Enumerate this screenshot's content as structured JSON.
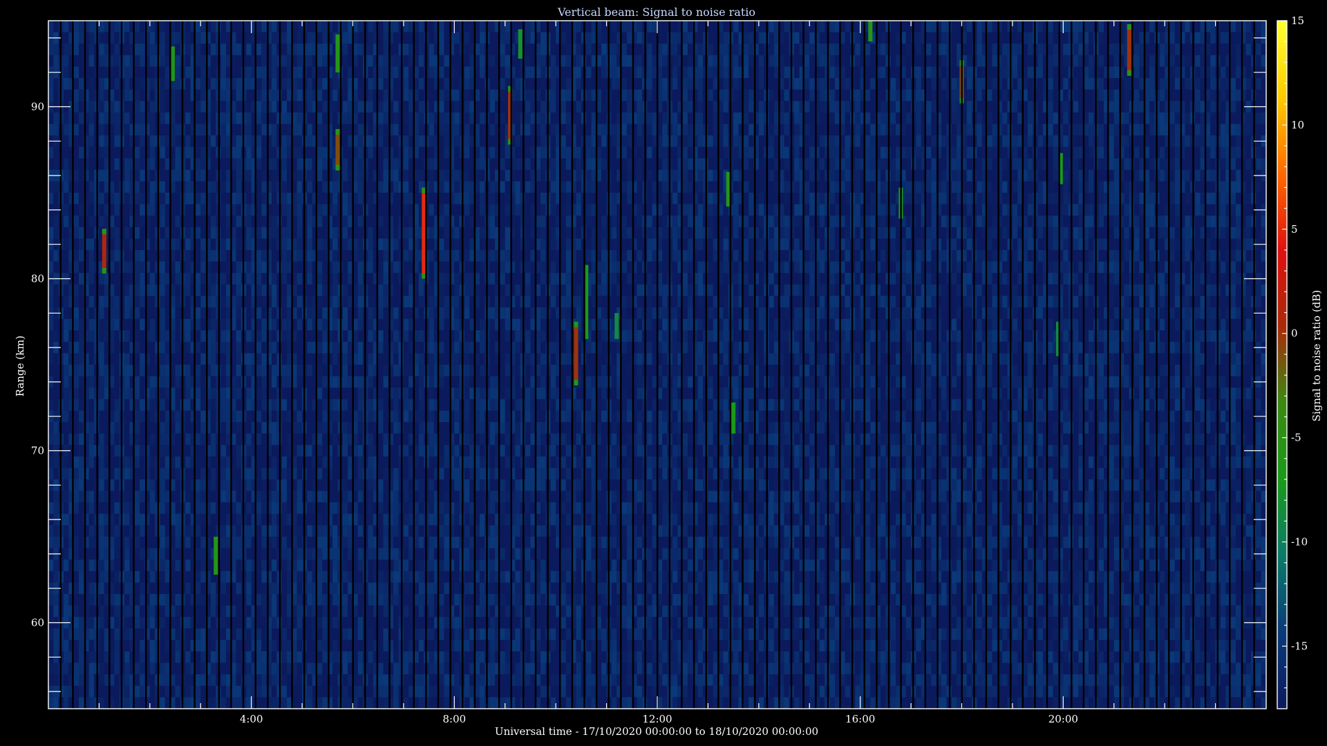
{
  "chart_data": {
    "type": "heatmap",
    "title": "Vertical beam: Signal to noise ratio",
    "xlabel": "Universal time - 17/10/2020 00:00:00 to 18/10/2020 00:00:00",
    "ylabel": "Range (km)",
    "colorbar_label": "Signal to noise ratio (dB)",
    "x_unit": "hours UT",
    "xlim": [
      0,
      24
    ],
    "ylim": [
      55,
      95
    ],
    "x_ticks": [
      4,
      8,
      12,
      16,
      20
    ],
    "x_tick_labels": [
      "4:00",
      "8:00",
      "12:00",
      "16:00",
      "20:00"
    ],
    "y_ticks": [
      60,
      70,
      80,
      90
    ],
    "y_tick_labels": [
      "60",
      "70",
      "80",
      "90"
    ],
    "colorbar_range": [
      -18,
      15
    ],
    "colorbar_ticks": [
      15,
      10,
      5,
      0,
      -5,
      -10,
      -15
    ],
    "colorbar_tick_labels": [
      "15",
      "10",
      "5",
      "0",
      "-5",
      "-10",
      "-15"
    ],
    "colormap": [
      "#0b1a5c",
      "#0a3a7a",
      "#0b7a6a",
      "#1a9a1a",
      "#3a8a10",
      "#aa2a0a",
      "#e01010",
      "#ff6a00",
      "#ffcc00",
      "#ffff30"
    ],
    "background_snr_db": -17,
    "grid": false,
    "echoes": [
      {
        "time_h": 1.1,
        "range_start_km": 80.3,
        "range_end_km": 82.9,
        "snr_db": 1
      },
      {
        "time_h": 2.45,
        "range_start_km": 91.5,
        "range_end_km": 93.5,
        "snr_db": -6
      },
      {
        "time_h": 3.3,
        "range_start_km": 62.8,
        "range_end_km": 65.0,
        "snr_db": -6
      },
      {
        "time_h": 5.7,
        "range_start_km": 92.0,
        "range_end_km": 94.2,
        "snr_db": -6
      },
      {
        "time_h": 5.7,
        "range_start_km": 86.3,
        "range_end_km": 88.7,
        "snr_db": -1
      },
      {
        "time_h": 7.4,
        "range_start_km": 80.0,
        "range_end_km": 85.3,
        "snr_db": 5
      },
      {
        "time_h": 9.1,
        "range_start_km": 87.8,
        "range_end_km": 91.2,
        "snr_db": 0
      },
      {
        "time_h": 9.3,
        "range_start_km": 92.8,
        "range_end_km": 94.5,
        "snr_db": -8
      },
      {
        "time_h": 10.4,
        "range_start_km": 73.8,
        "range_end_km": 77.5,
        "snr_db": 0
      },
      {
        "time_h": 10.6,
        "range_start_km": 76.5,
        "range_end_km": 80.8,
        "snr_db": -7
      },
      {
        "time_h": 11.2,
        "range_start_km": 76.5,
        "range_end_km": 78.0,
        "snr_db": -9
      },
      {
        "time_h": 13.4,
        "range_start_km": 84.2,
        "range_end_km": 86.2,
        "snr_db": -6
      },
      {
        "time_h": 13.5,
        "range_start_km": 71.0,
        "range_end_km": 72.8,
        "snr_db": -7
      },
      {
        "time_h": 16.2,
        "range_start_km": 93.8,
        "range_end_km": 95.0,
        "snr_db": -6
      },
      {
        "time_h": 16.8,
        "range_start_km": 83.5,
        "range_end_km": 85.3,
        "snr_db": -7
      },
      {
        "time_h": 18.0,
        "range_start_km": 90.2,
        "range_end_km": 92.7,
        "snr_db": -1
      },
      {
        "time_h": 19.95,
        "range_start_km": 85.5,
        "range_end_km": 87.3,
        "snr_db": -7
      },
      {
        "time_h": 19.9,
        "range_start_km": 75.5,
        "range_end_km": 77.5,
        "snr_db": -9
      },
      {
        "time_h": 21.3,
        "range_start_km": 91.8,
        "range_end_km": 94.8,
        "snr_db": 0
      }
    ]
  }
}
